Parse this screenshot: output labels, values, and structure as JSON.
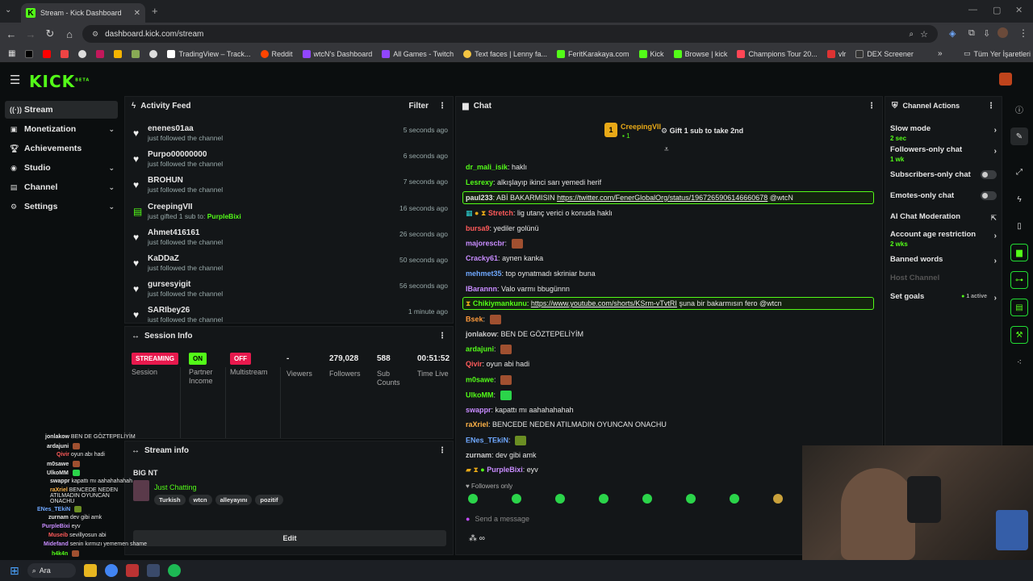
{
  "browser": {
    "tab_title": "Stream - Kick Dashboard",
    "tab_close": "✕",
    "new_tab": "+",
    "url": "dashboard.kick.com/stream",
    "bookmarks": [
      "TradingView – Track...",
      "Reddit",
      "wtcN's Dashboard",
      "All Games - Twitch",
      "Text faces | Lenny fa...",
      "FeritKarakaya.com",
      "Kick",
      "Browse | kick",
      "Champions Tour 20...",
      "vlr",
      "DEX Screener"
    ],
    "all_bookmarks": "Tüm Yer İşaretleri",
    "colors": {
      "tab_bg": "#35363a",
      "chrome_bg": "#1f2124"
    }
  },
  "brand": {
    "logo": "KICK",
    "beta": "BETA",
    "color": "#53fc18"
  },
  "sidebar": {
    "items": [
      {
        "label": "Stream",
        "icon": "stream-icon"
      },
      {
        "label": "Monetization",
        "icon": "dollar-icon"
      },
      {
        "label": "Achievements",
        "icon": "trophy-icon"
      },
      {
        "label": "Studio",
        "icon": "studio-icon"
      },
      {
        "label": "Channel",
        "icon": "channel-icon"
      },
      {
        "label": "Settings",
        "icon": "gear-icon"
      }
    ]
  },
  "activity": {
    "title": "Activity Feed",
    "filter": "Filter",
    "items": [
      {
        "name": "enenes01aa",
        "sub": "just followed the channel",
        "time": "5 seconds ago"
      },
      {
        "name": "Purpo00000000",
        "sub": "just followed the channel",
        "time": "6 seconds ago"
      },
      {
        "name": "BROHUN",
        "sub": "just followed the channel",
        "time": "7 seconds ago"
      },
      {
        "name": "CreepingVII",
        "sub": "just gifted 1 sub to:",
        "target": "PurpleBixi",
        "time": "16 seconds ago"
      },
      {
        "name": "Ahmet416161",
        "sub": "just followed the channel",
        "time": "26 seconds ago"
      },
      {
        "name": "KaDDaZ",
        "sub": "just followed the channel",
        "time": "50 seconds ago"
      },
      {
        "name": "gursesyigit",
        "sub": "just followed the channel",
        "time": "56 seconds ago"
      },
      {
        "name": "SARIbey26",
        "sub": "just followed the channel",
        "time": "1 minute ago"
      }
    ]
  },
  "session": {
    "title": "Session Info",
    "streaming": "STREAMING",
    "session_label": "Session",
    "partner_badge": "ON",
    "partner_label": "Partner Income",
    "multi_badge": "OFF",
    "multi_label": "Multistream",
    "viewers_val": "-",
    "viewers_label": "Viewers",
    "followers_val": "279,028",
    "followers_label": "Followers",
    "subs_val": "588",
    "subs_label": "Sub Counts",
    "time_val": "00:51:52",
    "time_label": "Time Live"
  },
  "streaminfo": {
    "title": "Stream info",
    "stream_title": "BIG NT",
    "category": "Just Chatting",
    "tags": [
      "Turkish",
      "wtcn",
      "alleyayını",
      "pozitif"
    ],
    "edit": "Edit"
  },
  "chat": {
    "title": "Chat",
    "pinned_user": "CreepingVII",
    "pinned_count": "1",
    "pinned_msg": "Gift 1 sub to take 2nd",
    "messages": [
      {
        "user": "dr_mali_isik",
        "color": "#53fc18",
        "text": "haklı"
      },
      {
        "user": "Lesrexy",
        "color": "#53fc18",
        "text": "alkışlayıp ikinci sarı yemedi herif"
      },
      {
        "user": "paul233",
        "color": "#ffffff",
        "text": "ABİ BAKARMISIN",
        "link": "https://twitter.com/FenerGlobalOrg/status/1967265906146660678",
        "after": "@wtcN",
        "highlight": true
      },
      {
        "user": "Stretch",
        "color": "#ff5a5a",
        "text": "lig utanç verici o konuda haklı"
      },
      {
        "user": "bursa9",
        "color": "#ff5a5a",
        "text": "yediler golünü"
      },
      {
        "user": "majorescbr",
        "color": "#c88cff",
        "text": ""
      },
      {
        "user": "Cracky61",
        "color": "#c88cff",
        "text": "aynen kanka"
      },
      {
        "user": "mehmet35",
        "color": "#6fa8ff",
        "text": "top oynatmadı skriniar buna"
      },
      {
        "user": "IBarannn",
        "color": "#c88cff",
        "text": "Valo varmı bbugünnn"
      },
      {
        "user": "Chikiymankunu",
        "color": "#53fc18",
        "text": "",
        "link": "https://www.youtube.com/shorts/KSrm-vTvtRI",
        "after": "şuna bir bakarmısın fero @wtcn",
        "highlight": true
      },
      {
        "user": "Bsek",
        "color": "#ff9a3c",
        "text": ""
      },
      {
        "user": "jonlakow",
        "color": "#cccccc",
        "text": "BEN DE GÖZTEPELİYİM"
      },
      {
        "user": "ardajuni",
        "color": "#53fc18",
        "text": ""
      },
      {
        "user": "Qivir",
        "color": "#ff5a5a",
        "text": "oyun abi hadi"
      },
      {
        "user": "m0sawe",
        "color": "#53fc18",
        "text": ""
      },
      {
        "user": "UlkoMM",
        "color": "#53fc18",
        "text": ""
      },
      {
        "user": "swappr",
        "color": "#c88cff",
        "text": "kapattı mı aahahahahah"
      },
      {
        "user": "raXriel",
        "color": "#ffb347",
        "text": "BENCEDE NEDEN ATILMADIN OYUNCAN ONACHU"
      },
      {
        "user": "ENes_TEkiN",
        "color": "#6fa8ff",
        "text": ""
      },
      {
        "user": "zurnam",
        "color": "#cccccc",
        "text": "dev gibi amk"
      },
      {
        "user": "PurpleBixi",
        "color": "#c88cff",
        "text": "eyv"
      }
    ],
    "followers_only": "Followers only",
    "placeholder": "Send a message"
  },
  "actions": {
    "title": "Channel Actions",
    "slow_mode": "Slow mode",
    "slow_val": "2 sec",
    "followers_only": "Followers-only chat",
    "followers_val": "1 wk",
    "subs_only": "Subscribers-only chat",
    "emotes_only": "Emotes-only chat",
    "ai_mod": "AI Chat Moderation",
    "age": "Account age restriction",
    "age_val": "2 wks",
    "banned": "Banned words",
    "host": "Host Channel",
    "goals": "Set goals",
    "goals_val": "1 active"
  },
  "overlay": {
    "lines": [
      {
        "user": "jonlakow",
        "text": "BEN DE GÖZTEPELİYİM"
      },
      {
        "user": "ardajuni",
        "text": ""
      },
      {
        "user": "Qivir",
        "text": "oyun abı hadi"
      },
      {
        "user": "m0sawe",
        "text": ""
      },
      {
        "user": "UlkoMM",
        "text": ""
      },
      {
        "user": "swappr",
        "text": "kapattı mı aahahahahah"
      },
      {
        "user": "raXriel",
        "text": "BENCEDE NEDEN ATILMADIN OYUNCAN ONACHU"
      },
      {
        "user": "ENes_TEkiN",
        "text": ""
      },
      {
        "user": "zurnam",
        "text": "dev gibi amk"
      },
      {
        "user": "PurpleBixi",
        "text": "eyv"
      },
      {
        "user": "Museib",
        "text": "sevillyosun abi"
      },
      {
        "user": "Midefand",
        "text": "senin kırmızı yememen shame"
      },
      {
        "user": "h4k4n",
        "text": ""
      }
    ]
  },
  "taskbar": {
    "search": "Ara"
  }
}
